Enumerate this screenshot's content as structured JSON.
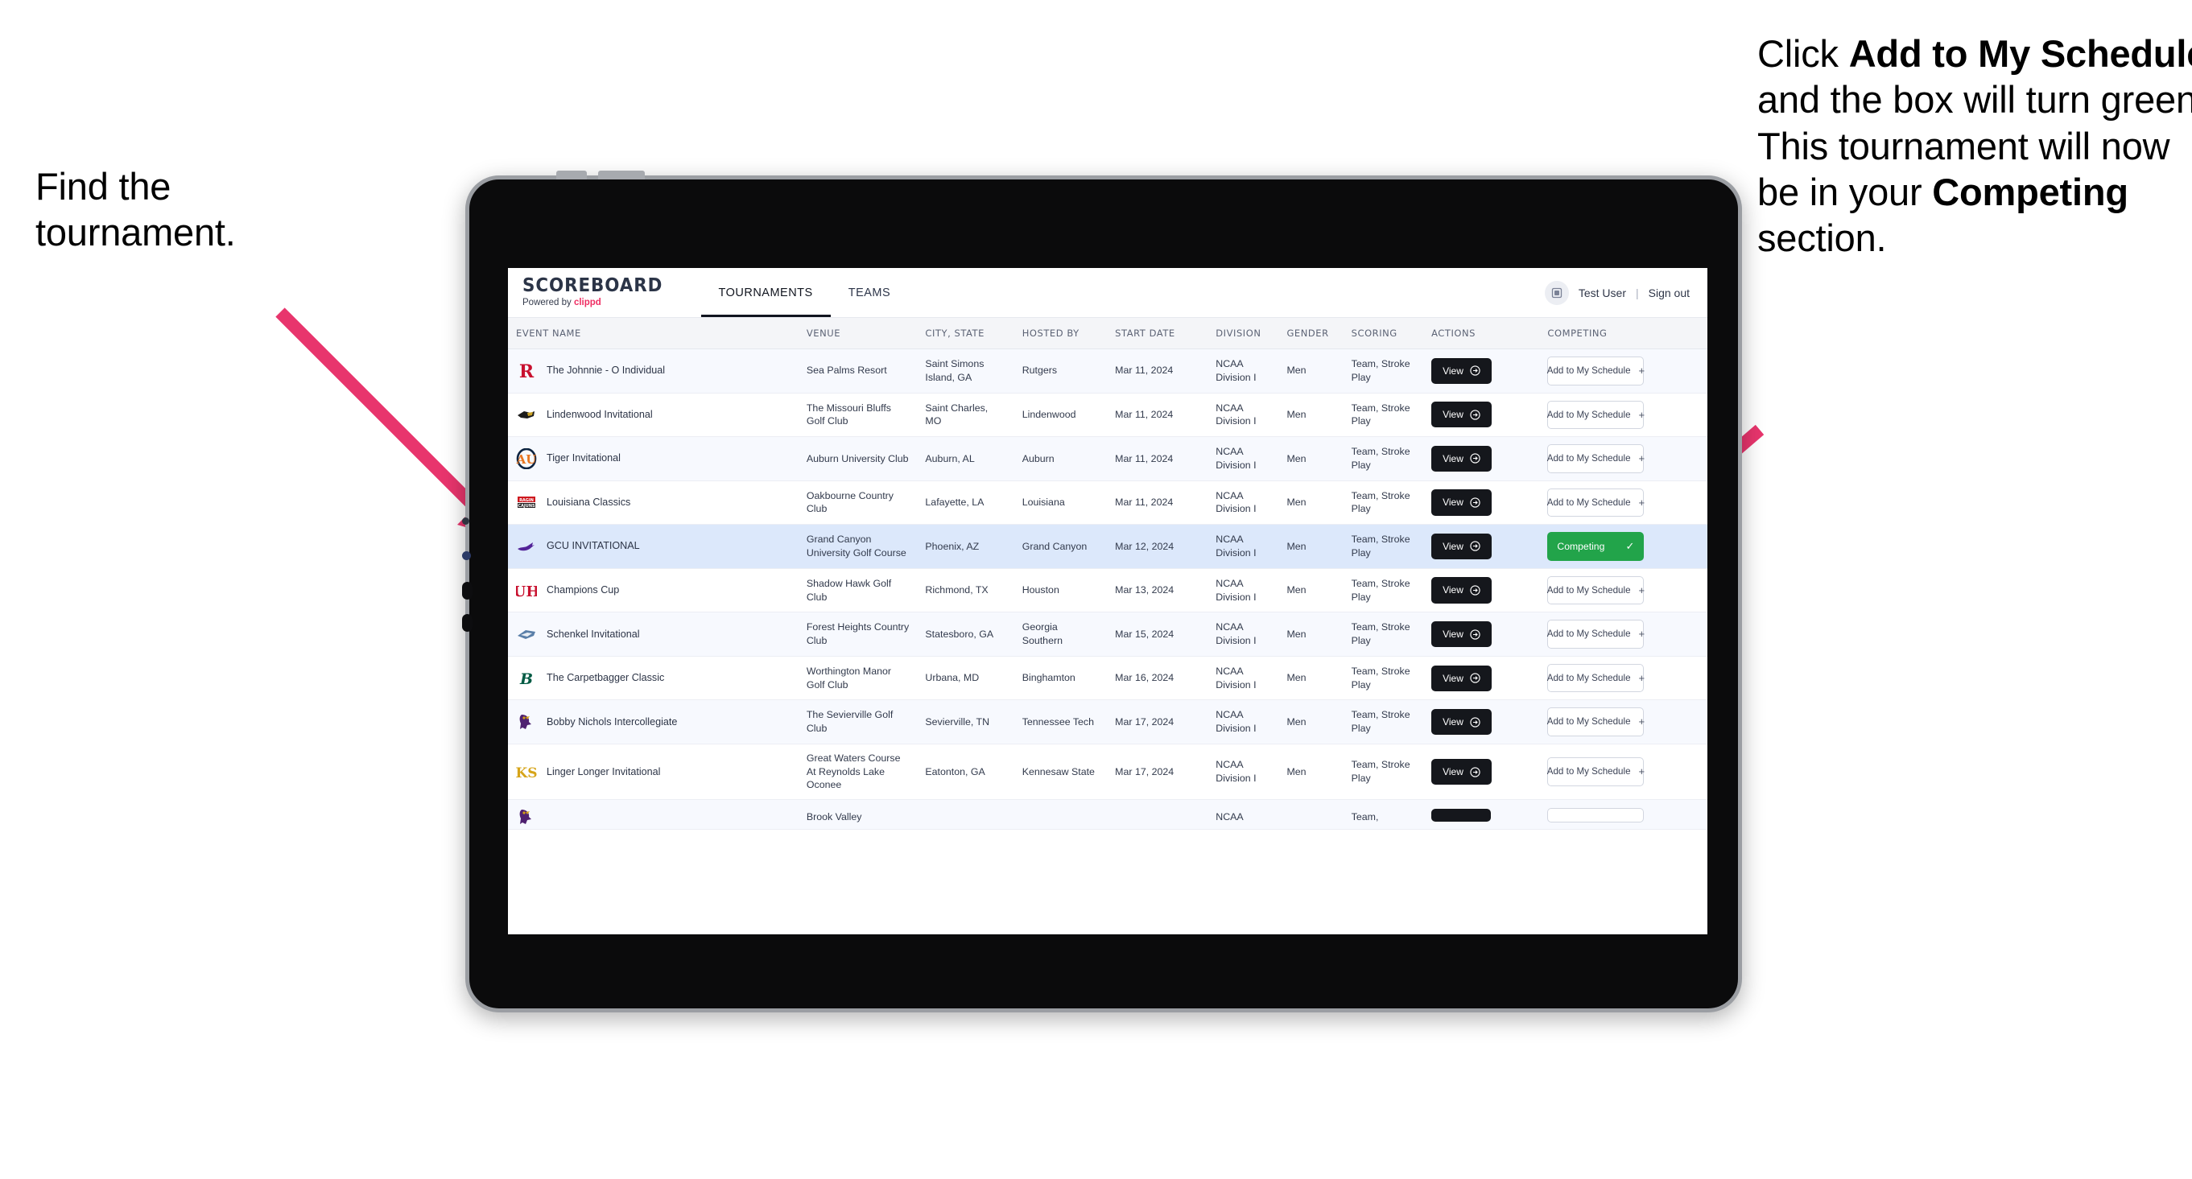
{
  "annotations": {
    "left": {
      "line1": "Find the",
      "line2": "tournament."
    },
    "right": {
      "s1": "Click ",
      "b1": "Add to My Schedule",
      "s2": " and the box will turn green. This tournament will now be in your ",
      "b2": "Competing",
      "s3": " section."
    }
  },
  "app": {
    "brand": {
      "title": "SCOREBOARD",
      "powered_prefix": "Powered by ",
      "powered_name": "clippd"
    },
    "nav": [
      {
        "label": "TOURNAMENTS",
        "active": true
      },
      {
        "label": "TEAMS",
        "active": false
      }
    ],
    "user": {
      "name": "Test User",
      "separator": "|",
      "signout": "Sign out",
      "avatar_icon": "user-avatar-icon"
    },
    "table": {
      "columns": [
        "EVENT NAME",
        "VENUE",
        "CITY, STATE",
        "HOSTED BY",
        "START DATE",
        "DIVISION",
        "GENDER",
        "SCORING",
        "ACTIONS",
        "COMPETING"
      ],
      "action_label": "View",
      "add_label": "Add to My Schedule",
      "add_plus": "+",
      "competing_label": "Competing",
      "competing_check": "✓",
      "rows": [
        {
          "event": "The Johnnie - O Individual",
          "venue": "Sea Palms Resort",
          "city": "Saint Simons Island, GA",
          "host": "Rutgers",
          "date": "Mar 11, 2024",
          "division": "NCAA Division I",
          "gender": "Men",
          "scoring": "Team, Stroke Play",
          "competing": false,
          "logo": "rutgers-r-logo"
        },
        {
          "event": "Lindenwood Invitational",
          "venue": "The Missouri Bluffs Golf Club",
          "city": "Saint Charles, MO",
          "host": "Lindenwood",
          "date": "Mar 11, 2024",
          "division": "NCAA Division I",
          "gender": "Men",
          "scoring": "Team, Stroke Play",
          "competing": false,
          "logo": "lindenwood-lion-logo"
        },
        {
          "event": "Tiger Invitational",
          "venue": "Auburn University Club",
          "city": "Auburn, AL",
          "host": "Auburn",
          "date": "Mar 11, 2024",
          "division": "NCAA Division I",
          "gender": "Men",
          "scoring": "Team, Stroke Play",
          "competing": false,
          "logo": "auburn-au-logo"
        },
        {
          "event": "Louisiana Classics",
          "venue": "Oakbourne Country Club",
          "city": "Lafayette, LA",
          "host": "Louisiana",
          "date": "Mar 11, 2024",
          "division": "NCAA Division I",
          "gender": "Men",
          "scoring": "Team, Stroke Play",
          "competing": false,
          "logo": "louisiana-ragin-cajuns-logo"
        },
        {
          "event": "GCU INVITATIONAL",
          "venue": "Grand Canyon University Golf Course",
          "city": "Phoenix, AZ",
          "host": "Grand Canyon",
          "date": "Mar 12, 2024",
          "division": "NCAA Division I",
          "gender": "Men",
          "scoring": "Team, Stroke Play",
          "competing": true,
          "logo": "grand-canyon-lope-logo"
        },
        {
          "event": "Champions Cup",
          "venue": "Shadow Hawk Golf Club",
          "city": "Richmond, TX",
          "host": "Houston",
          "date": "Mar 13, 2024",
          "division": "NCAA Division I",
          "gender": "Men",
          "scoring": "Team, Stroke Play",
          "competing": false,
          "logo": "houston-uh-logo"
        },
        {
          "event": "Schenkel Invitational",
          "venue": "Forest Heights Country Club",
          "city": "Statesboro, GA",
          "host": "Georgia Southern",
          "date": "Mar 15, 2024",
          "division": "NCAA Division I",
          "gender": "Men",
          "scoring": "Team, Stroke Play",
          "competing": false,
          "logo": "georgia-southern-eagles-logo"
        },
        {
          "event": "The Carpetbagger Classic",
          "venue": "Worthington Manor Golf Club",
          "city": "Urbana, MD",
          "host": "Binghamton",
          "date": "Mar 16, 2024",
          "division": "NCAA Division I",
          "gender": "Men",
          "scoring": "Team, Stroke Play",
          "competing": false,
          "logo": "binghamton-b-logo"
        },
        {
          "event": "Bobby Nichols Intercollegiate",
          "venue": "The Sevierville Golf Club",
          "city": "Sevierville, TN",
          "host": "Tennessee Tech",
          "date": "Mar 17, 2024",
          "division": "NCAA Division I",
          "gender": "Men",
          "scoring": "Team, Stroke Play",
          "competing": false,
          "logo": "tennessee-tech-eagle-logo"
        },
        {
          "event": "Linger Longer Invitational",
          "venue": "Great Waters Course At Reynolds Lake Oconee",
          "city": "Eatonton, GA",
          "host": "Kennesaw State",
          "date": "Mar 17, 2024",
          "division": "NCAA Division I",
          "gender": "Men",
          "scoring": "Team, Stroke Play",
          "competing": false,
          "logo": "kennesaw-state-ks-logo"
        }
      ],
      "partial_row": {
        "venue": "Brook Valley",
        "division": "NCAA",
        "scoring": "Team,"
      }
    }
  },
  "colors": {
    "accent_pink": "#ef2e63",
    "arrow_pink": "#e8356d",
    "competing_green": "#22a44a",
    "selected_row": "#dce8fb",
    "dark_button": "#15171c",
    "brand_navy": "#2b3447"
  }
}
